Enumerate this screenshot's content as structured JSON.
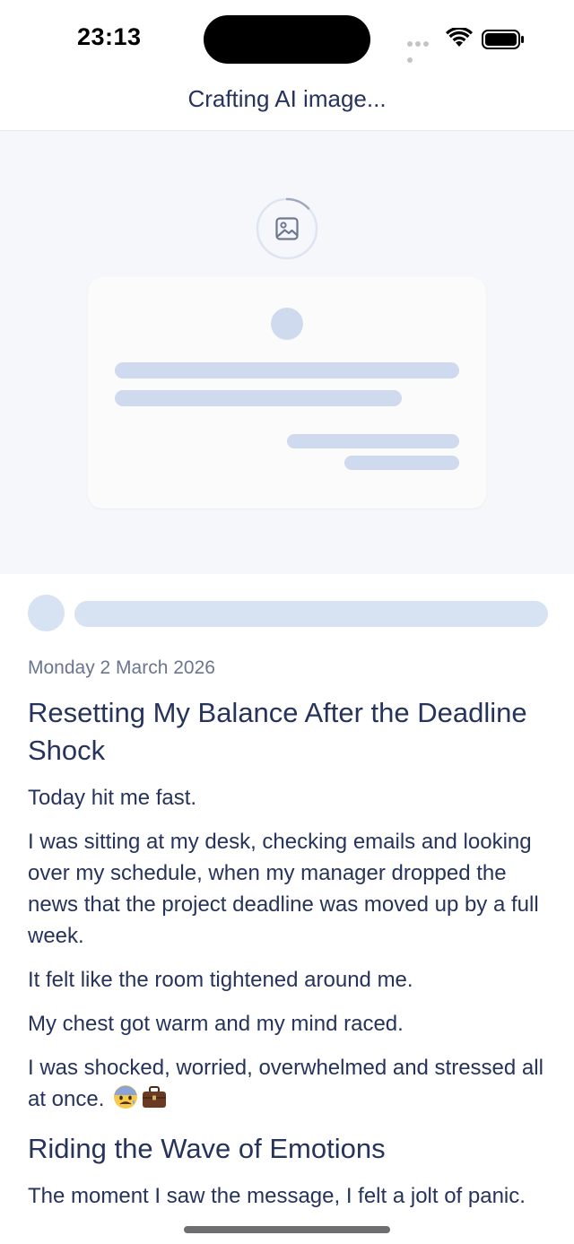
{
  "status_bar": {
    "time": "23:13"
  },
  "header": {
    "title": "Crafting AI image..."
  },
  "image_placeholder": {
    "icon": "image-icon",
    "status": "loading"
  },
  "article": {
    "date": "Monday 2 March 2026",
    "title": "Resetting My Balance After the Deadline Shock",
    "paragraphs": [
      "Today hit me fast.",
      "I was sitting at my desk, checking emails and looking over my schedule, when my manager dropped the news that the project deadline was moved up by a full week.",
      "It felt like the room tightened around me.",
      "My chest got warm and my mind raced.",
      "I was shocked, worried, overwhelmed and stressed all at once."
    ],
    "emojis": [
      "anxious-face-icon",
      "briefcase-icon"
    ],
    "section_heading": "Riding the Wave of Emotions",
    "section_paragraphs": [
      "The moment I saw the message, I felt a jolt of panic."
    ]
  },
  "colors": {
    "text": "#26335b",
    "skeleton": "#cfdaee",
    "image_area_bg": "#f6f7fa"
  }
}
